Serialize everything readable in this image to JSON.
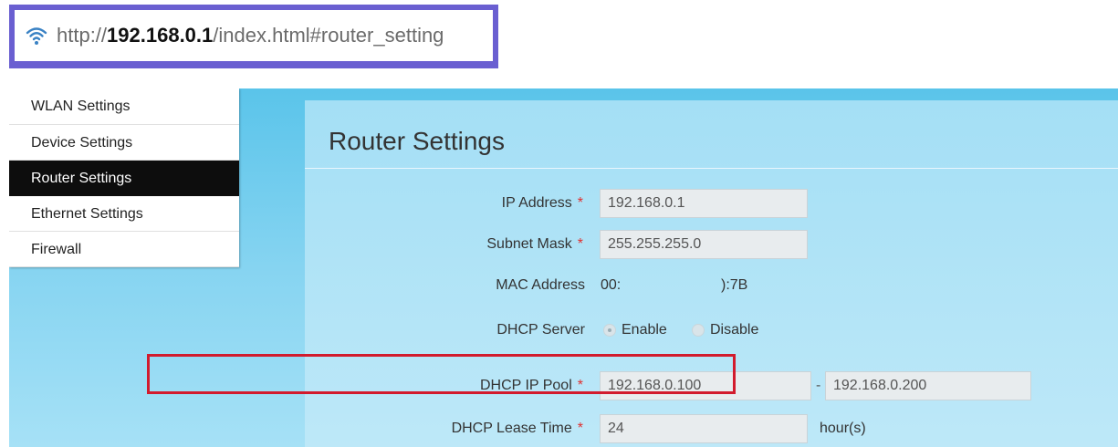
{
  "address_bar": {
    "url_prefix": "http://",
    "url_host": "192.168.0.1",
    "url_path": "/index.html#router_setting",
    "icon": "wifi-icon",
    "frame_color": "#6a5fd1"
  },
  "menu": {
    "items": [
      {
        "label": "WLAN Settings",
        "active": false
      },
      {
        "label": "Device Settings",
        "active": false
      },
      {
        "label": "Router Settings",
        "active": true
      },
      {
        "label": "Ethernet Settings",
        "active": false
      },
      {
        "label": "Firewall",
        "active": false
      }
    ]
  },
  "page": {
    "title": "Router Settings"
  },
  "form": {
    "required_mark": "*",
    "ip_address": {
      "label": "IP Address",
      "value": "192.168.0.1"
    },
    "subnet_mask": {
      "label": "Subnet Mask",
      "value": "255.255.255.0"
    },
    "mac_address": {
      "label": "MAC Address",
      "value_start": "00:",
      "value_end": "):7B"
    },
    "dhcp_server": {
      "label": "DHCP Server",
      "option_enable": "Enable",
      "option_disable": "Disable",
      "selected": "Enable"
    },
    "dhcp_ip_pool": {
      "label": "DHCP IP Pool",
      "start": "192.168.0.100",
      "separator": "-",
      "end": "192.168.0.200"
    },
    "dhcp_lease_time": {
      "label": "DHCP Lease Time",
      "value": "24",
      "unit": "hour(s)"
    }
  },
  "colors": {
    "highlight": "#d21b2d",
    "active_menu_bg": "#0d0d0d",
    "required": "#e03030"
  }
}
